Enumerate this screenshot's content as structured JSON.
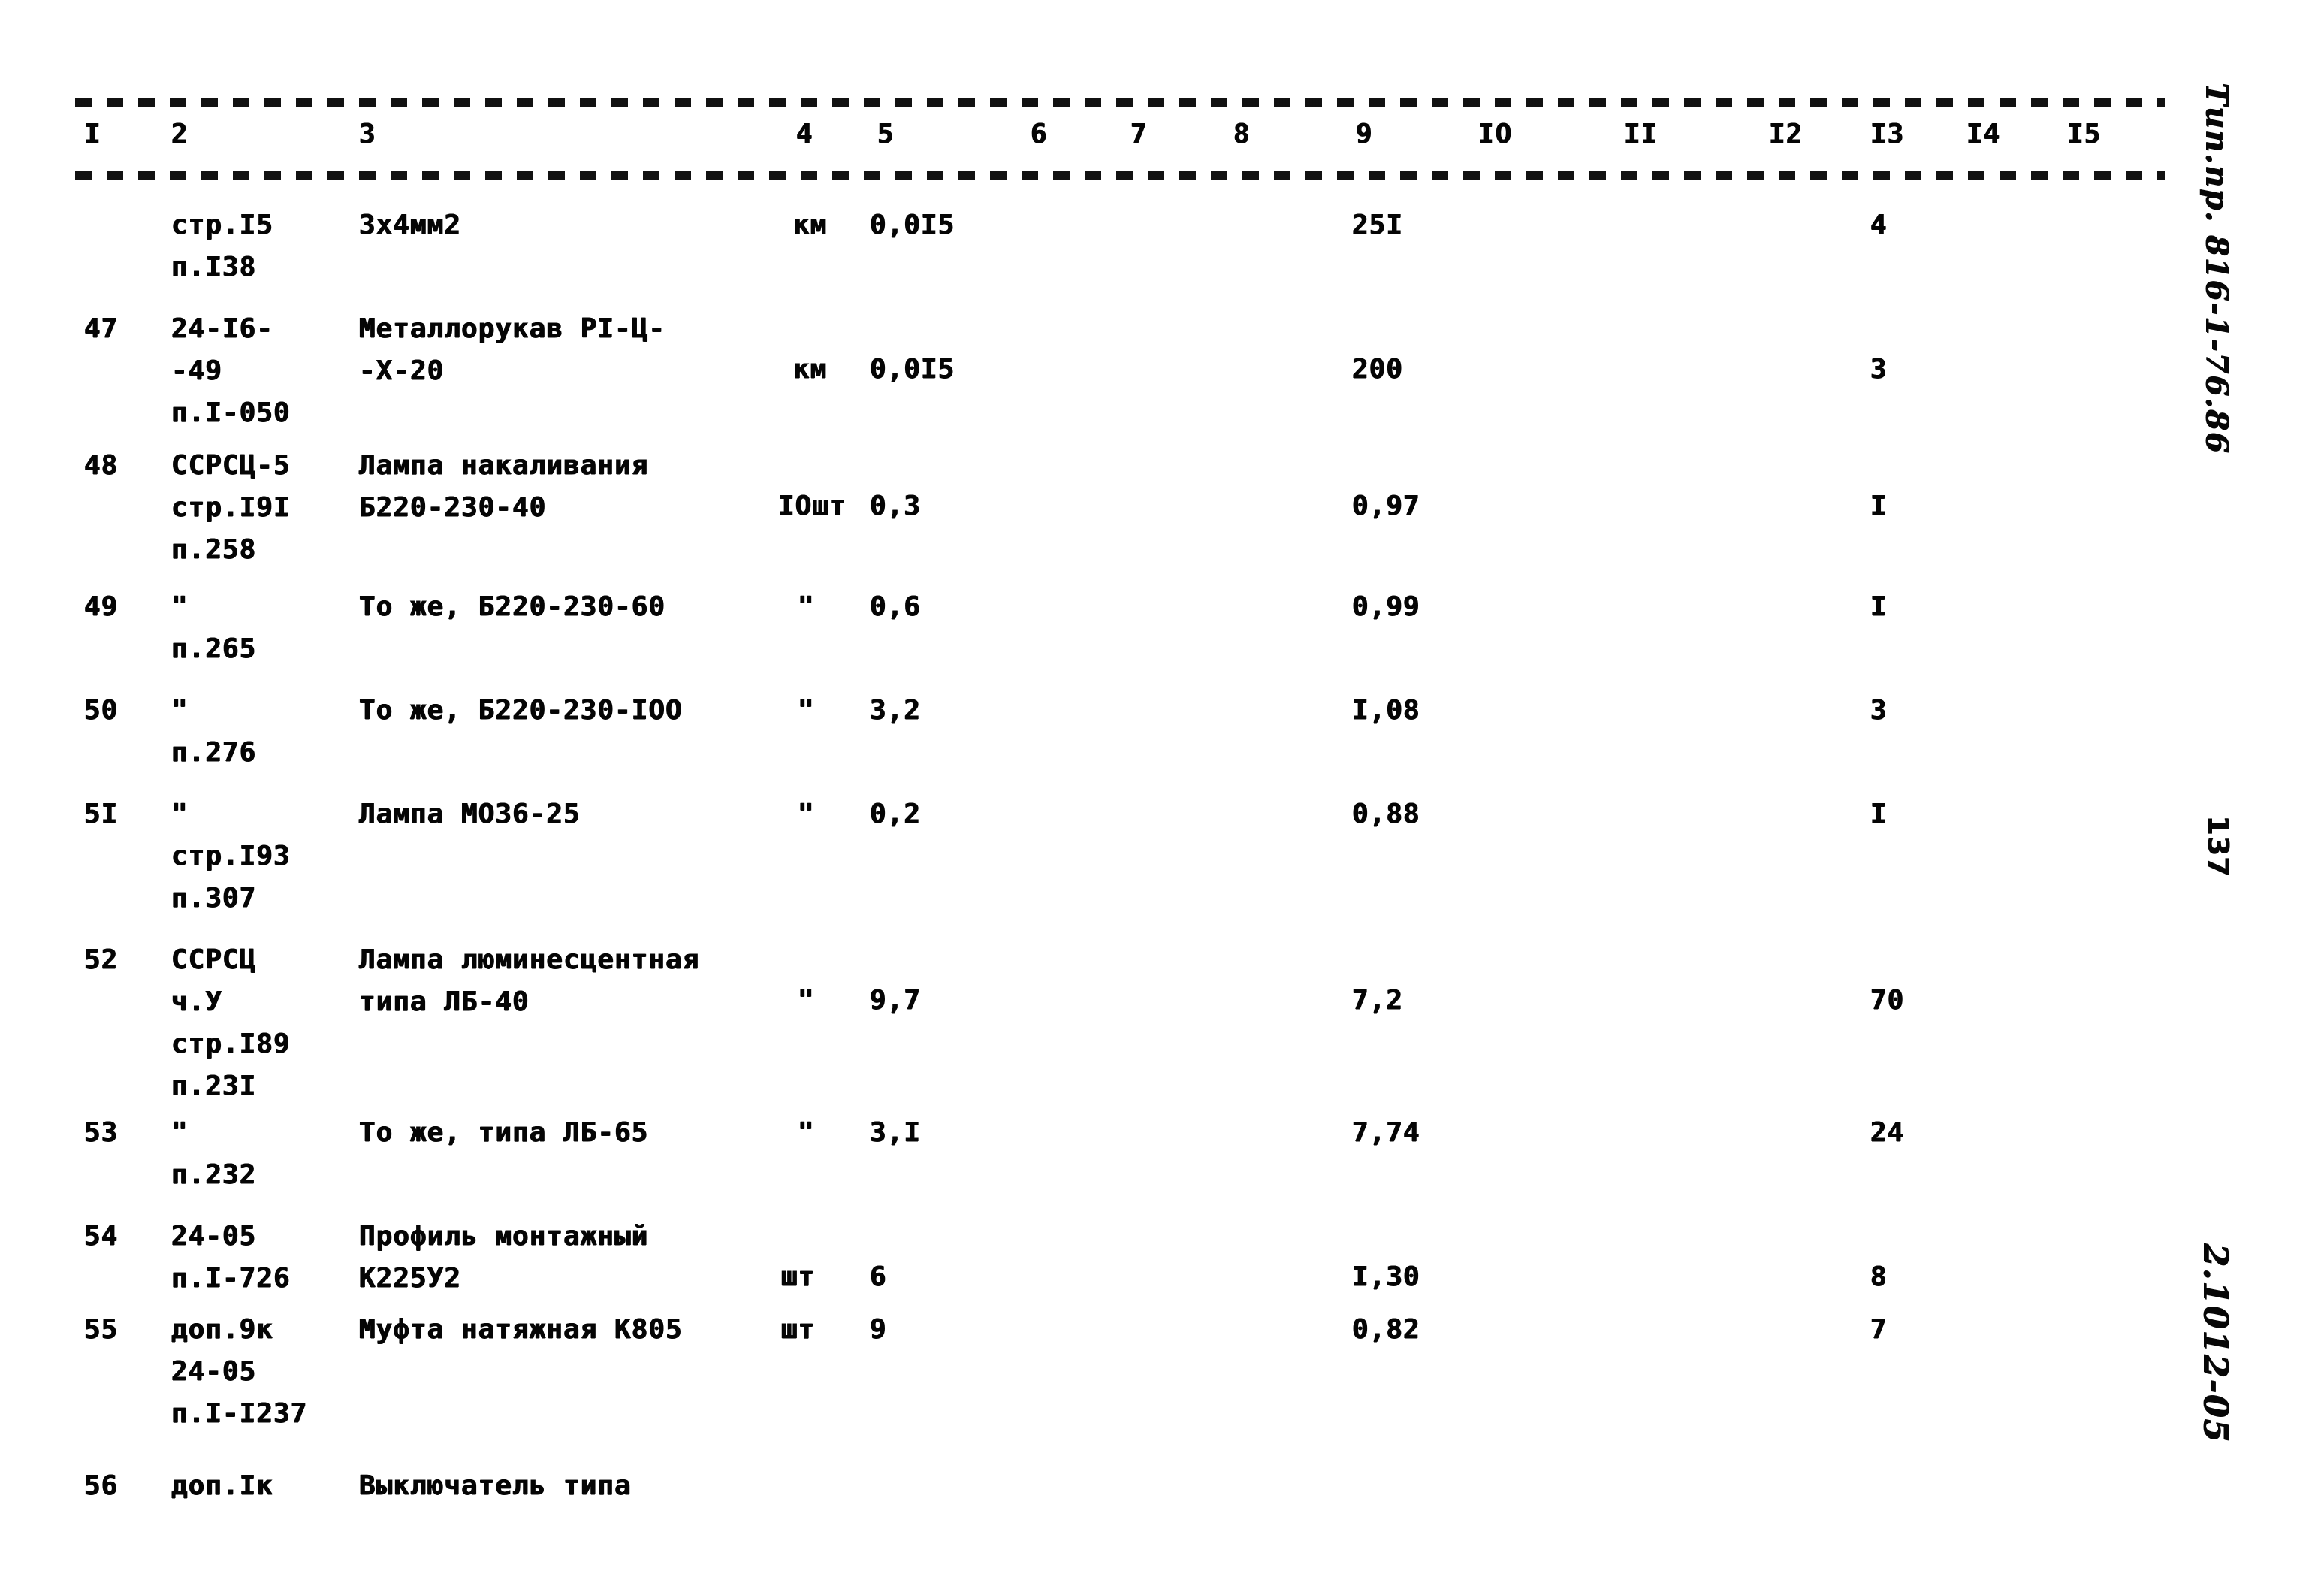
{
  "document": {
    "type": "scanned-specification-table",
    "page_number": "137",
    "margin_stamp_top": "Тип.пр. 816-1-76.86",
    "margin_stamp_bottom": "2.1012-05"
  },
  "table": {
    "column_headers": [
      "I",
      "2",
      "3",
      "4",
      "5",
      "6",
      "7",
      "8",
      "9",
      "IO",
      "II",
      "I2",
      "I3",
      "I4",
      "I5"
    ],
    "rows": [
      {
        "c1": "",
        "c2": "стр.I5\nп.I38",
        "c3": "3х4мм2",
        "c4": "км",
        "c5": "0,0I5",
        "c9": "25I",
        "c13": "4"
      },
      {
        "c1": "47",
        "c2": "24-I6-\n-49\nп.I-050",
        "c3": "Металлорукав РI-Ц-\n-Х-20",
        "c4": "км",
        "c5": "0,0I5",
        "c9": "200",
        "c13": "3"
      },
      {
        "c1": "48",
        "c2": "ССРСЦ-5\nстр.I9I\nп.258",
        "c3": "Лампа накаливания\nБ220-230-40",
        "c4": "IOшт",
        "c5": "0,3",
        "c9": "0,97",
        "c13": "I"
      },
      {
        "c1": "49",
        "c2": "\"\nп.265",
        "c3": "То же, Б220-230-60",
        "c4": "\"",
        "c5": "0,6",
        "c9": "0,99",
        "c13": "I"
      },
      {
        "c1": "50",
        "c2": "\"\nп.276",
        "c3": "То же, Б220-230-IOO",
        "c4": "\"",
        "c5": "3,2",
        "c9": "I,08",
        "c13": "3"
      },
      {
        "c1": "5I",
        "c2": "\"\nстр.I93\nп.307",
        "c3": "Лампа МО36-25",
        "c4": "\"",
        "c5": "0,2",
        "c9": "0,88",
        "c13": "I"
      },
      {
        "c1": "52",
        "c2": "ССРСЦ\nч.У\nстр.I89\nп.23I",
        "c3": "Лампа люминесцентная\nтипа ЛБ-40",
        "c4": "\"",
        "c5": "9,7",
        "c9": "7,2",
        "c13": "70"
      },
      {
        "c1": "53",
        "c2": "\"\nп.232",
        "c3": "То же, типа ЛБ-65",
        "c4": "\"",
        "c5": "3,I",
        "c9": "7,74",
        "c13": "24"
      },
      {
        "c1": "54",
        "c2": "24-05\nп.I-726",
        "c3": "Профиль монтажный\nК225У2",
        "c4": "шт",
        "c5": "6",
        "c9": "I,30",
        "c13": "8"
      },
      {
        "c1": "55",
        "c2": "доп.9к\n24-05\nп.I-I237",
        "c3": "Муфта натяжная К805",
        "c4": "шт",
        "c5": "9",
        "c9": "0,82",
        "c13": "7"
      },
      {
        "c1": "56",
        "c2": "доп.Iк",
        "c3": "Выключатель типа",
        "c4": "",
        "c5": "",
        "c9": "",
        "c13": ""
      }
    ]
  }
}
